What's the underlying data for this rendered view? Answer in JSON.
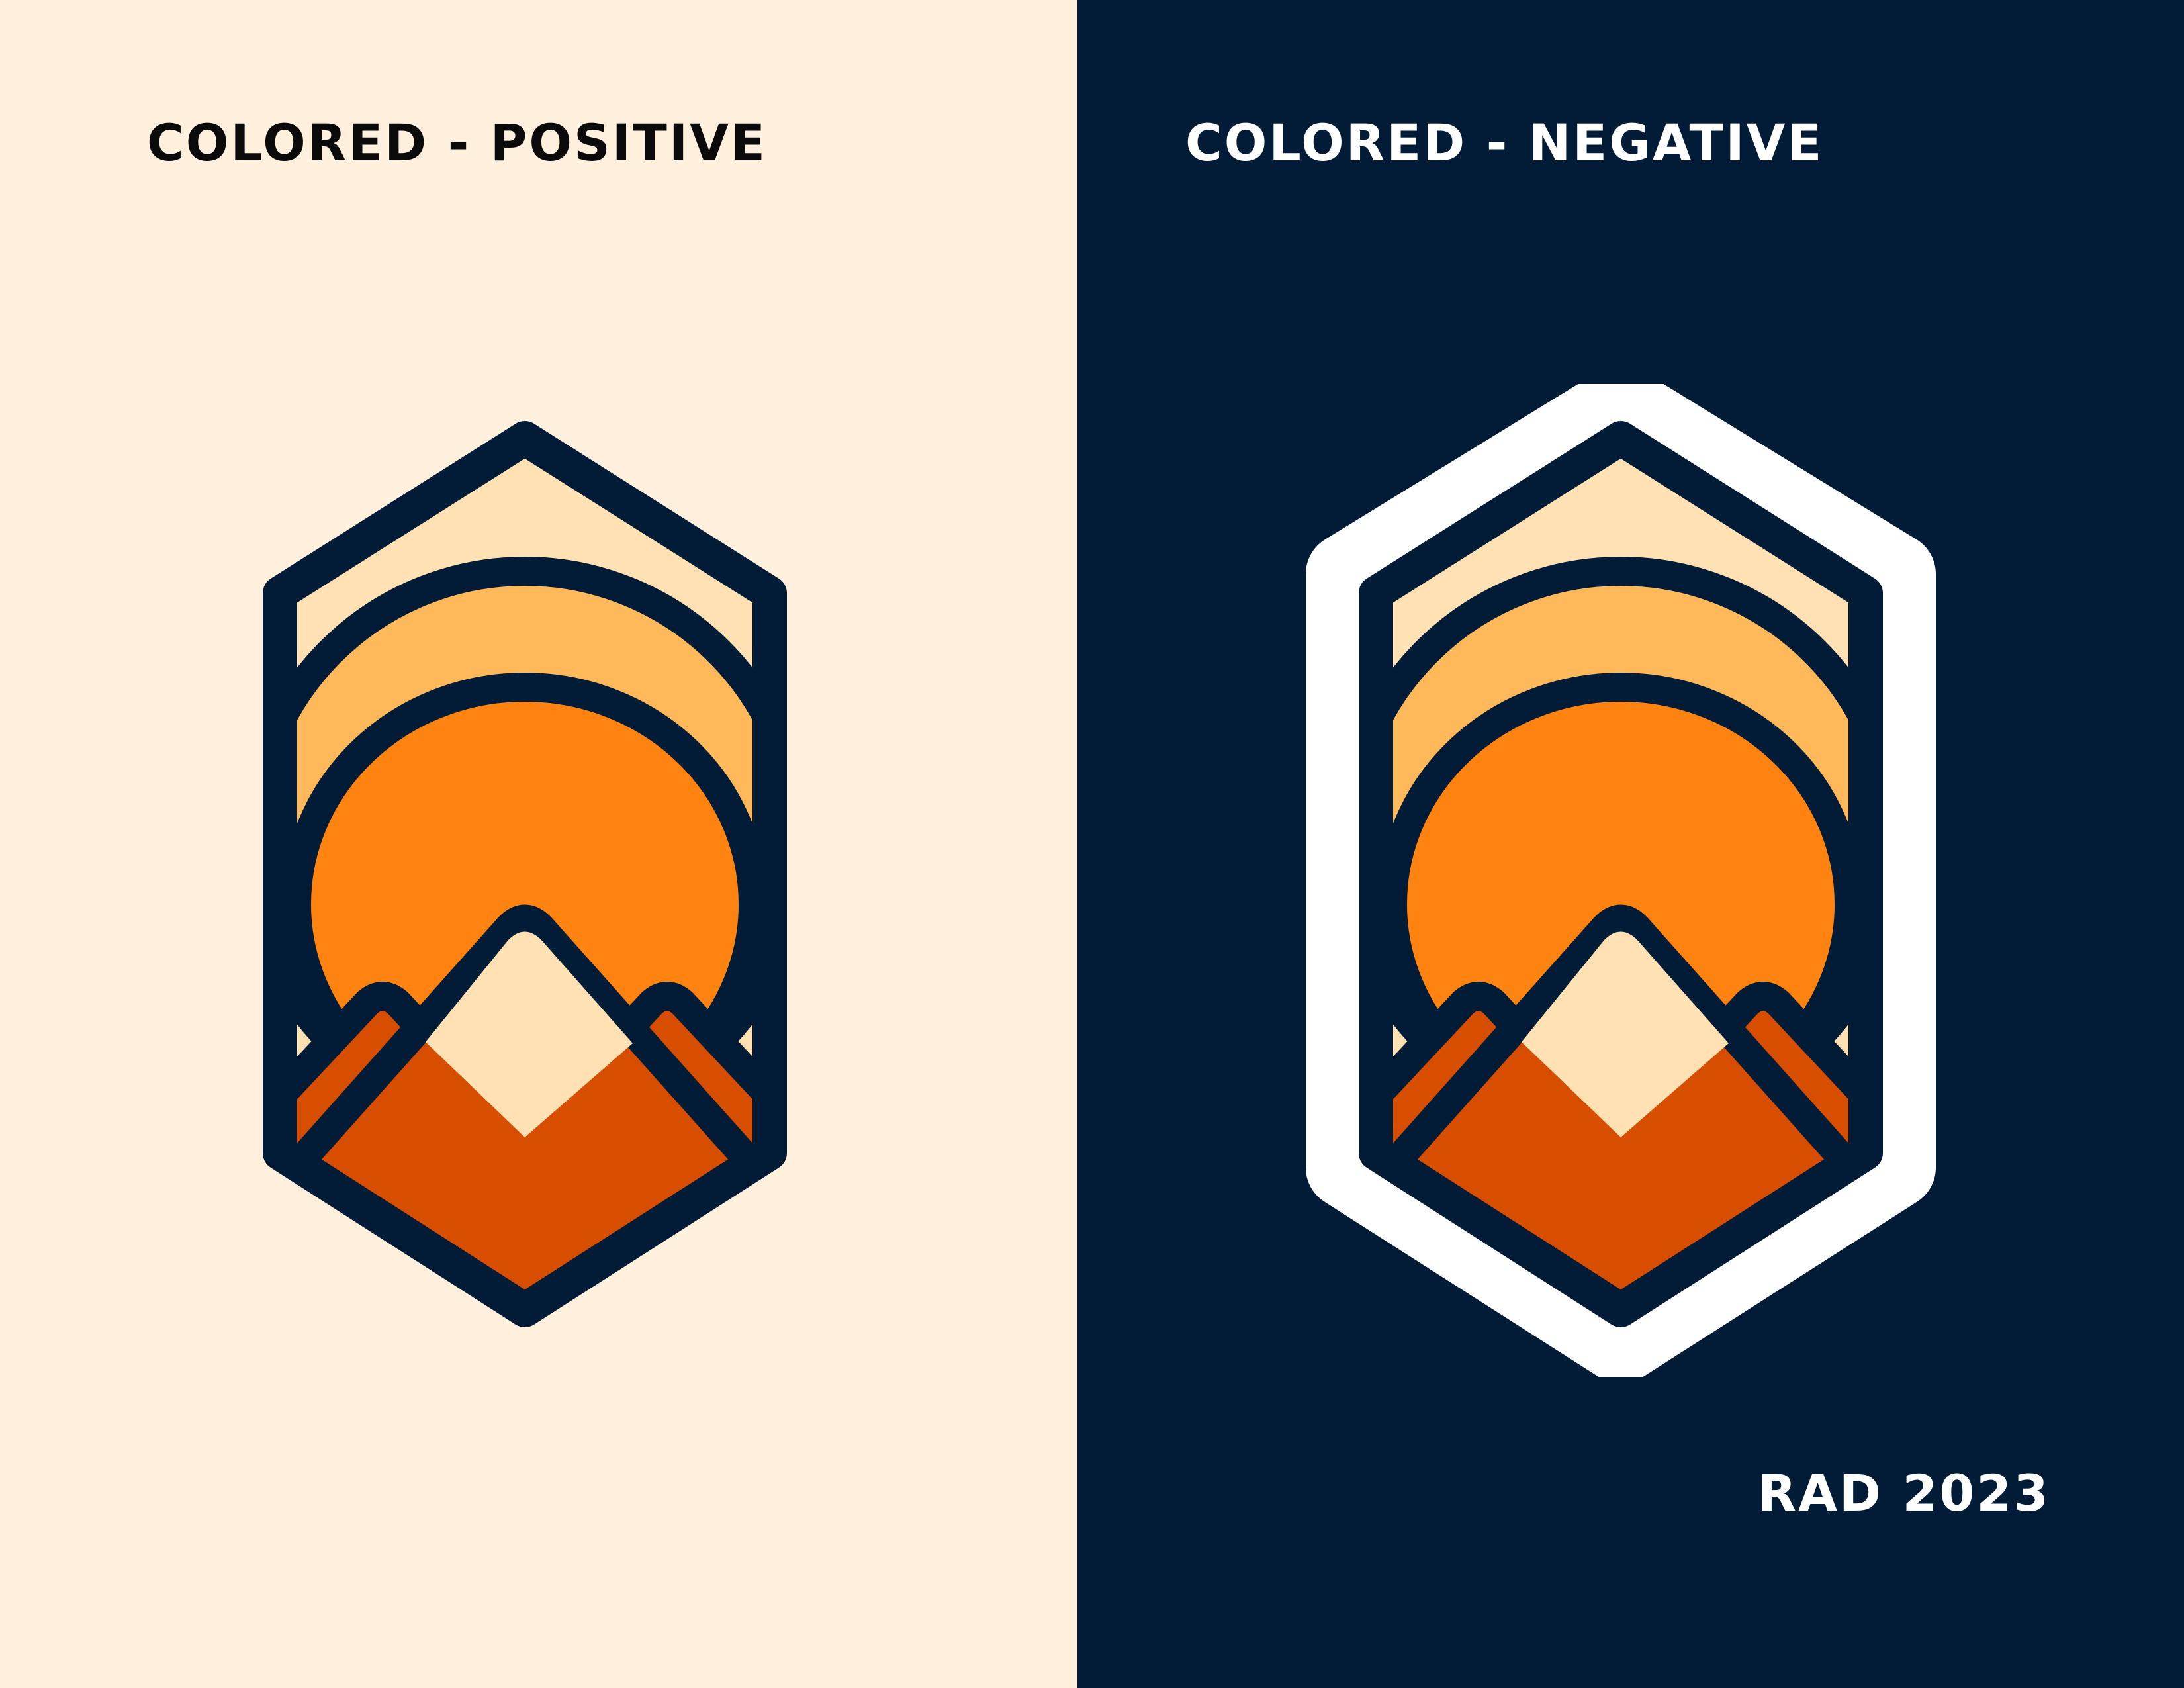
{
  "colors": {
    "cream_background": "#FFF0DE",
    "navy_background": "#021C37",
    "badge_outline": "#021C37",
    "sky_light": "#FFE1B3",
    "sun_halo": "#FFB95A",
    "sun": "#FF8311",
    "mountain": "#D84E00",
    "snow_cap": "#FFE1B3",
    "white_border": "#FFFFFF",
    "text_dark": "#0A0A0A",
    "text_light": "#FFFFFF"
  },
  "left_panel": {
    "title": "COLORED - POSITIVE"
  },
  "right_panel": {
    "title": "COLORED - NEGATIVE",
    "credit": "RAD 2023"
  }
}
